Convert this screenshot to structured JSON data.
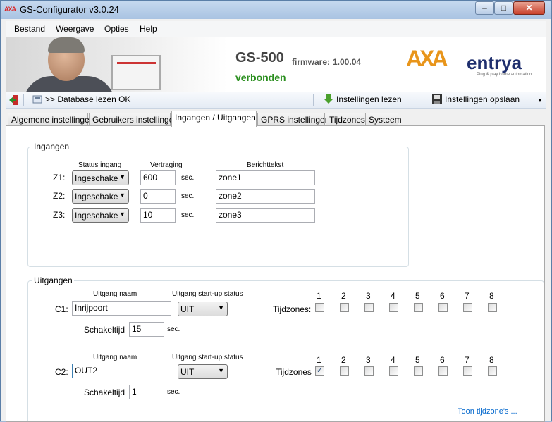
{
  "window": {
    "title": "GS-Configurator v3.0.24",
    "icon_text": "AXA"
  },
  "window_controls": {
    "minimize": "–",
    "maximize": "□",
    "close": "✕"
  },
  "menu": [
    "Bestand",
    "Weergave",
    "Opties",
    "Help"
  ],
  "banner": {
    "model": "GS-500",
    "firmware_label": "firmware:",
    "firmware_version": "1.00.04",
    "status": "verbonden",
    "logo_mark": "AXA",
    "logo_word": "entrya",
    "logo_tagline": "Plug & play home automation"
  },
  "toolbar": {
    "status": ">> Database lezen OK",
    "read_settings": "Instellingen lezen",
    "save_settings": "Instellingen opslaan"
  },
  "tabs": [
    "Algemene instellingen",
    "Gebruikers instellingen",
    "Ingangen / Uitgangen",
    "GPRS instellingen",
    "Tijdzones",
    "Systeem"
  ],
  "active_tab": "Ingangen / Uitgangen",
  "inputs_group": {
    "title": "Ingangen",
    "col_status": "Status ingang",
    "col_delay": "Vertraging",
    "col_message": "Berichttekst",
    "unit": "sec.",
    "rows": [
      {
        "zone": "Z1:",
        "status": "Ingeschake",
        "delay": "600",
        "message": "zone1"
      },
      {
        "zone": "Z2:",
        "status": "Ingeschake",
        "delay": "0",
        "message": "zone2"
      },
      {
        "zone": "Z3:",
        "status": "Ingeschake",
        "delay": "10",
        "message": "zone3"
      }
    ]
  },
  "outputs_group": {
    "title": "Uitgangen",
    "col_name": "Uitgang naam",
    "col_startup": "Uitgang start-up status",
    "switch_time_label": "Schakeltijd",
    "unit": "sec.",
    "timezone_numbers": [
      "1",
      "2",
      "3",
      "4",
      "5",
      "6",
      "7",
      "8"
    ],
    "outputs": [
      {
        "id": "C1:",
        "name": "Inrijpoort",
        "startup": "UIT",
        "switch_time": "15",
        "timezones_label": "Tijdzones:",
        "timezones_checked": [
          false,
          false,
          false,
          false,
          false,
          false,
          false,
          false
        ]
      },
      {
        "id": "C2:",
        "name": "OUT2",
        "startup": "UIT",
        "switch_time": "1",
        "timezones_label": "Tijdzones",
        "timezones_checked": [
          true,
          false,
          false,
          false,
          false,
          false,
          false,
          false
        ]
      }
    ],
    "show_timezones_link": "Toon tijdzone's ..."
  }
}
